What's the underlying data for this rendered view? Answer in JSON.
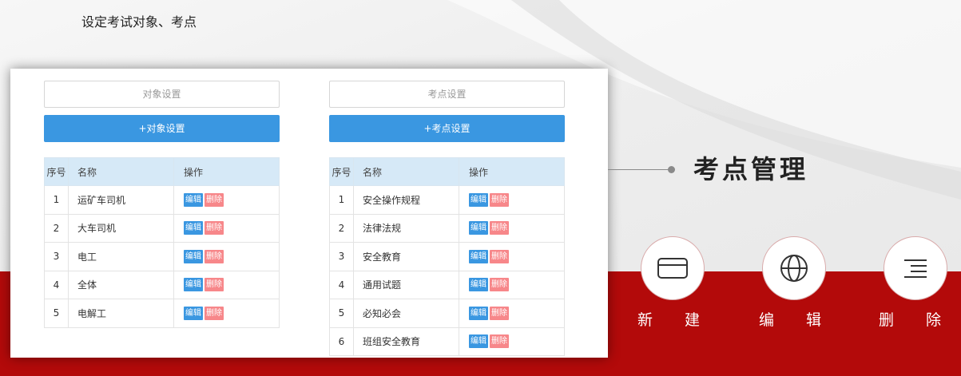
{
  "heading": "设定考试对象、考点",
  "section_title": "考点管理",
  "left": {
    "placeholder": "对象设置",
    "add_label": "+对象设置",
    "headers": {
      "no": "序号",
      "name": "名称",
      "op": "操作"
    },
    "rows": [
      {
        "no": "1",
        "name": "运矿车司机"
      },
      {
        "no": "2",
        "name": "大车司机"
      },
      {
        "no": "3",
        "name": "电工"
      },
      {
        "no": "4",
        "name": "全体"
      },
      {
        "no": "5",
        "name": "电解工"
      }
    ]
  },
  "right": {
    "placeholder": "考点设置",
    "add_label": "+考点设置",
    "headers": {
      "no": "序号",
      "name": "名称",
      "op": "操作"
    },
    "rows": [
      {
        "no": "1",
        "name": "安全操作规程"
      },
      {
        "no": "2",
        "name": "法律法规"
      },
      {
        "no": "3",
        "name": "安全教育"
      },
      {
        "no": "4",
        "name": "通用试题"
      },
      {
        "no": "5",
        "name": "必知必会"
      },
      {
        "no": "6",
        "name": "班组安全教育"
      }
    ]
  },
  "row_actions": {
    "edit": "编辑",
    "delete": "删除"
  },
  "actions": [
    {
      "label": "新建",
      "icon": "card-icon"
    },
    {
      "label": "编辑",
      "icon": "globe-icon"
    },
    {
      "label": "删除",
      "icon": "menu-lines-icon"
    }
  ],
  "colors": {
    "primary": "#3a97e1",
    "danger": "#f7878a",
    "brand_red": "#b30a0a",
    "table_header": "#d6e9f7"
  }
}
